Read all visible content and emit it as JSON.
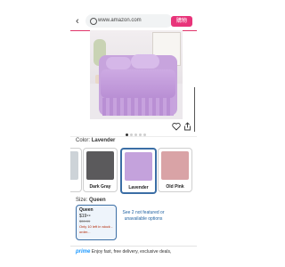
{
  "browser": {
    "url": "www.amazon.com",
    "shop_button": "購物"
  },
  "product": {
    "image_dots": {
      "count": 5,
      "active": 0
    }
  },
  "color": {
    "label": "Color:",
    "selected": "Lavender",
    "options": [
      {
        "label": "Dark Gray",
        "color": "#5b5a5c"
      },
      {
        "label": "Lavender",
        "color": "#c4a2dc"
      },
      {
        "label": "Old Pink",
        "color": "#d9a3a6"
      }
    ]
  },
  "size": {
    "label": "Size:",
    "selected": "Queen",
    "option": {
      "name": "Queen",
      "price": "$19⁹⁹",
      "list_price": "$39.99",
      "stock": "Only 10 left in stock - order..."
    },
    "see_more": "See 2 not featured or unavailable options"
  },
  "prime": {
    "word": "prime",
    "text": "Enjoy fast, free delivery, exclusive deals,"
  },
  "colors": {
    "accent": "#3b6ea5",
    "shop": "#e8347a",
    "stock": "#b12704",
    "link": "#2162a1",
    "prime": "#1a98ff"
  }
}
